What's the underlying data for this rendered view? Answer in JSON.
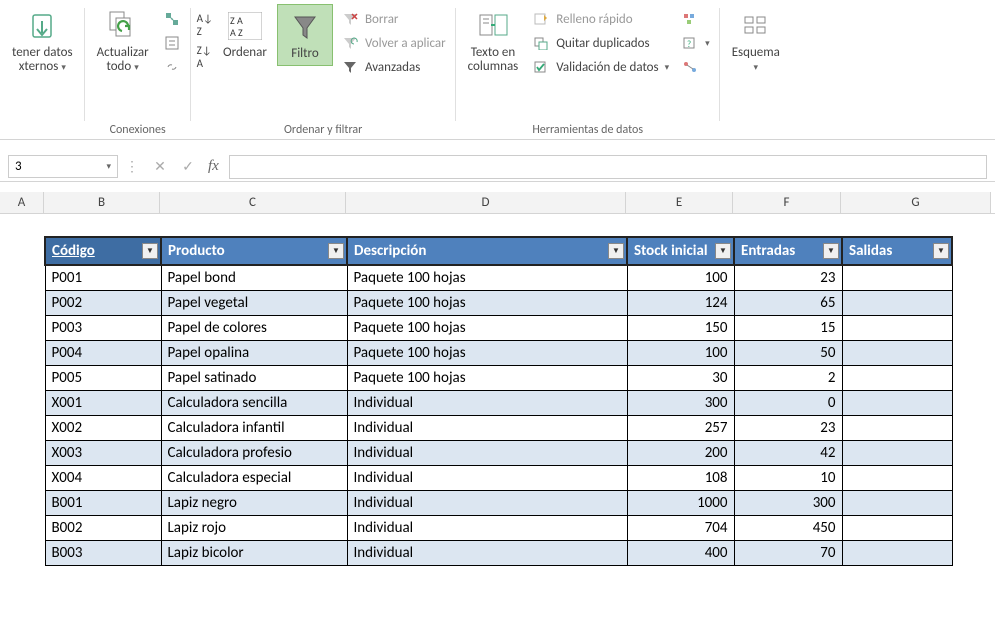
{
  "ribbon": {
    "obtenerDatos": {
      "label1": "tener datos",
      "label2": "xternos"
    },
    "actualizar": {
      "label1": "Actualizar",
      "label2": "todo"
    },
    "conexiones_group": "Conexiones",
    "ordenar": "Ordenar",
    "filtro": "Filtro",
    "borrar": "Borrar",
    "volverAplicar": "Volver a aplicar",
    "avanzadas": "Avanzadas",
    "ordenarFiltrar_group": "Ordenar y filtrar",
    "textoColumnas": {
      "label1": "Texto en",
      "label2": "columnas"
    },
    "rellenoRapido": "Relleno rápido",
    "quitarDuplicados": "Quitar duplicados",
    "validacionDatos": "Validación de datos",
    "herramientasDatos_group": "Herramientas de datos",
    "esquema": "Esquema"
  },
  "formulaBar": {
    "cellRef": "3",
    "formula": ""
  },
  "columns": [
    "A",
    "B",
    "C",
    "D",
    "E",
    "F",
    "G"
  ],
  "table": {
    "headers": [
      "Código",
      "Producto",
      "Descripción",
      "Stock inicial",
      "Entradas",
      "Salidas"
    ],
    "rows": [
      {
        "codigo": "P001",
        "producto": "Papel bond",
        "descripcion": "Paquete 100 hojas",
        "stock": "100",
        "entradas": "23",
        "salidas": ""
      },
      {
        "codigo": "P002",
        "producto": "Papel vegetal",
        "descripcion": "Paquete 100 hojas",
        "stock": "124",
        "entradas": "65",
        "salidas": ""
      },
      {
        "codigo": "P003",
        "producto": "Papel de colores",
        "descripcion": "Paquete 100 hojas",
        "stock": "150",
        "entradas": "15",
        "salidas": ""
      },
      {
        "codigo": "P004",
        "producto": "Papel opalina",
        "descripcion": "Paquete 100 hojas",
        "stock": "100",
        "entradas": "50",
        "salidas": ""
      },
      {
        "codigo": "P005",
        "producto": "Papel satinado",
        "descripcion": "Paquete 100 hojas",
        "stock": "30",
        "entradas": "2",
        "salidas": ""
      },
      {
        "codigo": "X001",
        "producto": "Calculadora sencilla",
        "descripcion": "Individual",
        "stock": "300",
        "entradas": "0",
        "salidas": ""
      },
      {
        "codigo": "X002",
        "producto": "Calculadora infantil",
        "descripcion": "Individual",
        "stock": "257",
        "entradas": "23",
        "salidas": ""
      },
      {
        "codigo": "X003",
        "producto": "Calculadora profesio",
        "descripcion": "Individual",
        "stock": "200",
        "entradas": "42",
        "salidas": ""
      },
      {
        "codigo": "X004",
        "producto": "Calculadora especial",
        "descripcion": "Individual",
        "stock": "108",
        "entradas": "10",
        "salidas": ""
      },
      {
        "codigo": "B001",
        "producto": "Lapiz negro",
        "descripcion": "Individual",
        "stock": "1000",
        "entradas": "300",
        "salidas": ""
      },
      {
        "codigo": "B002",
        "producto": "Lapiz rojo",
        "descripcion": "Individual",
        "stock": "704",
        "entradas": "450",
        "salidas": ""
      },
      {
        "codigo": "B003",
        "producto": "Lapiz bicolor",
        "descripcion": "Individual",
        "stock": "400",
        "entradas": "70",
        "salidas": ""
      }
    ]
  }
}
